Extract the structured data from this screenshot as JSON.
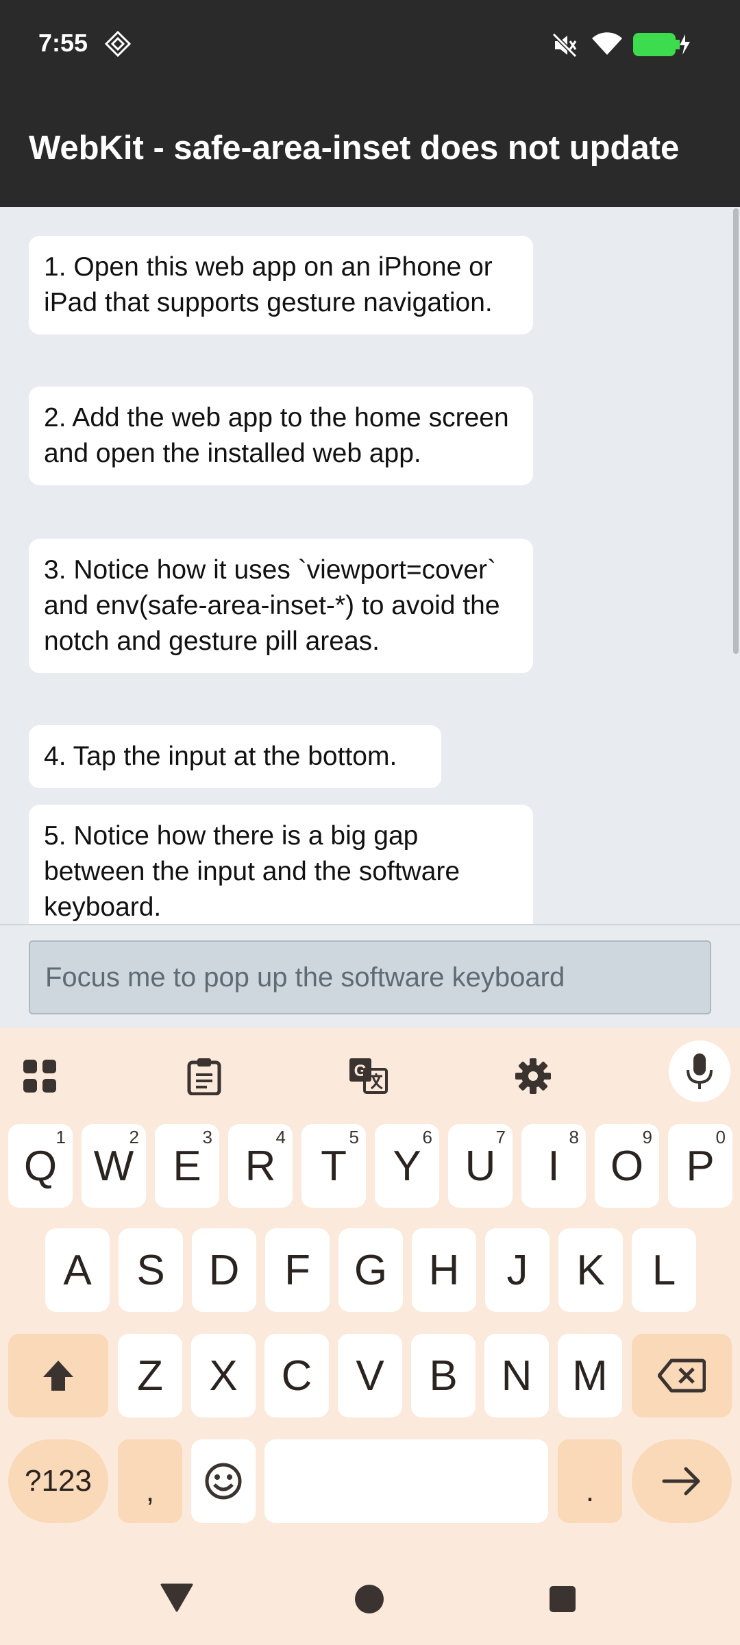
{
  "status_bar": {
    "time": "7:55"
  },
  "app_bar": {
    "title": "WebKit - safe-area-inset does not update"
  },
  "steps": [
    "1. Open this web app on an iPhone or iPad that supports gesture navigation.",
    "2. Add the web app to the home screen and open the installed web app.",
    "3. Notice how it uses `viewport=cover` and env(safe-area-inset-*) to avoid the notch and gesture pill areas.",
    "4. Tap the input at the bottom.",
    "5. Notice how there is a big gap between the input and the software keyboard."
  ],
  "input": {
    "placeholder": "Focus me to pop up the software keyboard",
    "value": ""
  },
  "keyboard": {
    "row1": [
      {
        "key": "Q",
        "hint": "1"
      },
      {
        "key": "W",
        "hint": "2"
      },
      {
        "key": "E",
        "hint": "3"
      },
      {
        "key": "R",
        "hint": "4"
      },
      {
        "key": "T",
        "hint": "5"
      },
      {
        "key": "Y",
        "hint": "6"
      },
      {
        "key": "U",
        "hint": "7"
      },
      {
        "key": "I",
        "hint": "8"
      },
      {
        "key": "O",
        "hint": "9"
      },
      {
        "key": "P",
        "hint": "0"
      }
    ],
    "row2": [
      "A",
      "S",
      "D",
      "F",
      "G",
      "H",
      "J",
      "K",
      "L"
    ],
    "row3": [
      "Z",
      "X",
      "C",
      "V",
      "B",
      "N",
      "M"
    ],
    "symbols_label": "?123",
    "comma_label": ",",
    "period_label": "."
  },
  "colors": {
    "app_bar": "#2a2a2a",
    "content_bg": "#e8ecf0",
    "keyboard_bg": "#fbeadb",
    "special_key": "#f9d9b8",
    "battery": "#3ddc4f"
  }
}
